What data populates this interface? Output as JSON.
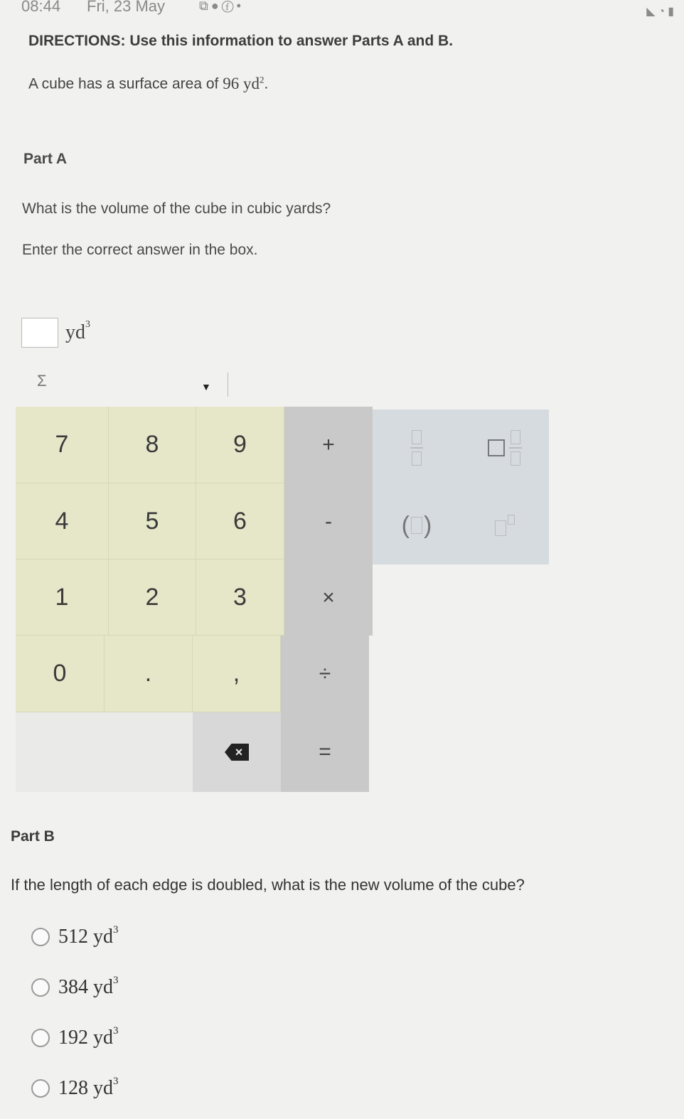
{
  "status_bar": {
    "time": "08:44",
    "date": "Fri, 23 May",
    "icons": [
      "media-icon",
      "dot-icon",
      "facebook-icon",
      "dot-icon"
    ],
    "right_icons": [
      "signal-icon",
      "wifi-icon",
      "battery-icon"
    ]
  },
  "directions": "DIRECTIONS: Use this information to answer Parts A and B.",
  "info": {
    "prefix": "A cube has a surface area of",
    "value": "96 yd",
    "exponent": "2",
    "suffix": "."
  },
  "part_a": {
    "title": "Part A",
    "question": "What is the volume of the cube in cubic yards?",
    "instruction": "Enter the correct answer in the box.",
    "answer_value": "",
    "unit": "yd",
    "unit_exponent": "3"
  },
  "toolbar": {
    "sigma": "Σ",
    "dropdown": "▼"
  },
  "keypad": {
    "digits": [
      "7",
      "8",
      "9",
      "4",
      "5",
      "6",
      "1",
      "2",
      "3",
      "0",
      ".",
      ","
    ],
    "operators": [
      "+",
      "-",
      "×",
      "÷",
      "="
    ],
    "format_icons": [
      "fraction-icon",
      "mixed-number-icon",
      "parentheses-icon",
      "exponent-icon"
    ],
    "delete_icon": "backspace-icon"
  },
  "part_b": {
    "title": "Part B",
    "question": "If the length of each edge is doubled, what is the new volume of the cube?",
    "options": [
      {
        "value": "512 yd",
        "exponent": "3"
      },
      {
        "value": "384 yd",
        "exponent": "3"
      },
      {
        "value": "192 yd",
        "exponent": "3"
      },
      {
        "value": "128 yd",
        "exponent": "3"
      }
    ]
  },
  "colors": {
    "background": "#f1f1ef",
    "number_keys": "#e6e6c9",
    "operator_keys": "#c9c9c9",
    "format_keys": "#d6dbe0"
  }
}
